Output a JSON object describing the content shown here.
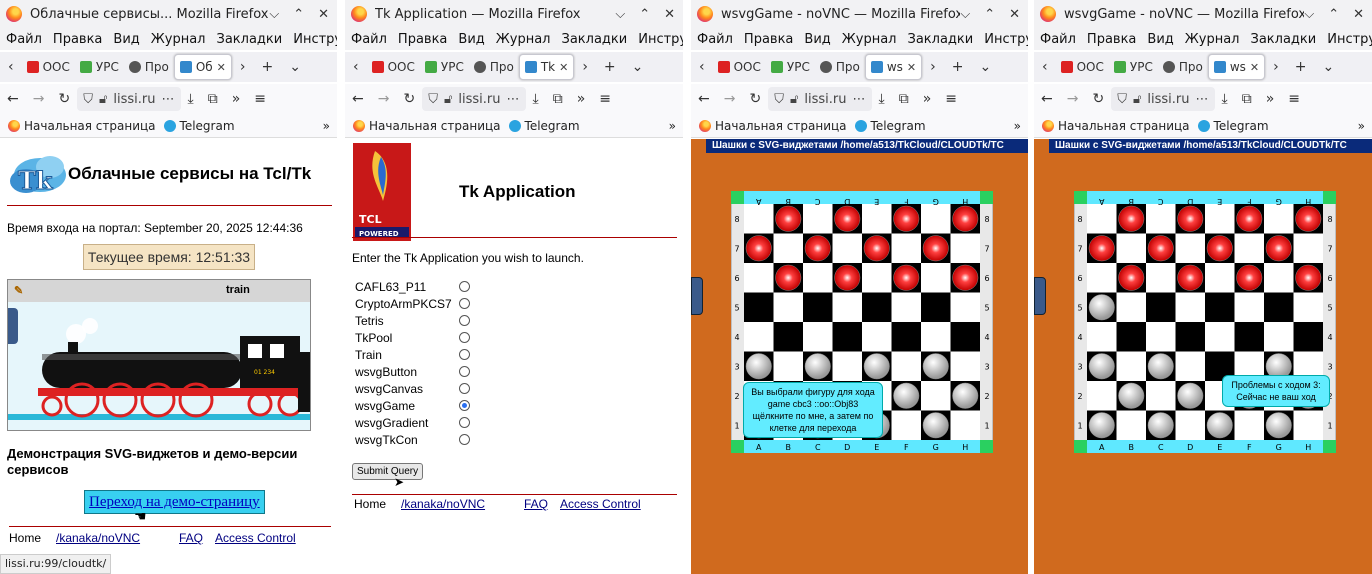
{
  "windows": [
    {
      "title": "Облачные сервисы... Mozilla Firefox",
      "menu": [
        "Файл",
        "Правка",
        "Вид",
        "Журнал",
        "Закладки",
        "Инструменты"
      ],
      "tabs": [
        {
          "label": "ООС",
          "active": false
        },
        {
          "label": "УРС",
          "active": false
        },
        {
          "label": "Про",
          "active": false
        },
        {
          "label": "Об",
          "active": true
        }
      ],
      "url": "lissi.ru",
      "bookmarks": [
        "Начальная страница",
        "Telegram"
      ]
    },
    {
      "title": "Tk Application — Mozilla Firefox",
      "menu": [
        "Файл",
        "Правка",
        "Вид",
        "Журнал",
        "Закладки",
        "Инструменты"
      ],
      "tabs": [
        {
          "label": "ООС",
          "active": false
        },
        {
          "label": "УРС",
          "active": false
        },
        {
          "label": "Про",
          "active": false
        },
        {
          "label": "Tk",
          "active": true
        }
      ],
      "url": "lissi.ru",
      "bookmarks": [
        "Начальная страница",
        "Telegram"
      ]
    },
    {
      "title": "wsvgGame - noVNC — Mozilla Firefox",
      "menu": [
        "Файл",
        "Правка",
        "Вид",
        "Журнал",
        "Закладки",
        "Инструменты"
      ],
      "tabs": [
        {
          "label": "ООС",
          "active": false
        },
        {
          "label": "УРС",
          "active": false
        },
        {
          "label": "Про",
          "active": false
        },
        {
          "label": "ws",
          "active": true
        }
      ],
      "url": "lissi.ru",
      "bookmarks": [
        "Начальная страница",
        "Telegram"
      ]
    },
    {
      "title": "wsvgGame - noVNC — Mozilla Firefox",
      "menu": [
        "Файл",
        "Правка",
        "Вид",
        "Журнал",
        "Закладки",
        "Инструменты"
      ],
      "tabs": [
        {
          "label": "ООС",
          "active": false
        },
        {
          "label": "УРС",
          "active": false
        },
        {
          "label": "Про",
          "active": false
        },
        {
          "label": "ws",
          "active": true
        }
      ],
      "url": "lissi.ru",
      "bookmarks": [
        "Начальная страница",
        "Telegram"
      ]
    }
  ],
  "portal": {
    "heading": "Облачные сервисы на Tcl/Tk",
    "login_time": "Время входа на портал: September 20, 2025 12:44:36",
    "current_time": "Текущее время: 12:51:33",
    "train_title": "train",
    "loco_number": "01 234",
    "demo_heading": "Демонстрация SVG-виджетов и демо-версии сервисов",
    "demo_link": "Переход на демо-страницу",
    "footer": {
      "home": "Home",
      "novnc": "/kanaka/noVNC",
      "faq": "FAQ",
      "access": "Access Control"
    },
    "status_url": "lissi.ru:99/cloudtk/"
  },
  "tkapp": {
    "logo_text": "TCL",
    "logo_sub": "POWERED",
    "heading": "Tk Application",
    "prompt": "Enter the Tk Application you wish to launch.",
    "apps": [
      "CAFL63_P11",
      "CryptoArmPKCS7",
      "Tetris",
      "TkPool",
      "Train",
      "wsvgButton",
      "wsvgCanvas",
      "wsvgGame",
      "wsvgGradient",
      "wsvgTkCon"
    ],
    "selected": "wsvgGame",
    "submit": "Submit Query",
    "footer": {
      "home": "Home",
      "novnc": "/kanaka/noVNC",
      "faq": "FAQ",
      "access": "Access Control"
    }
  },
  "game": {
    "window_title": "Шашки с SVG-виджетами /home/a513/TkCloud/CLOUDTk/TC",
    "window_title_b": "Шашки с SVG-виджетами /home/a513/TkCloud/CLOUDTk/TC",
    "files": [
      "A",
      "B",
      "C",
      "D",
      "E",
      "F",
      "G",
      "H"
    ],
    "ranks": [
      "8",
      "7",
      "6",
      "5",
      "4",
      "3",
      "2",
      "1"
    ],
    "tip_a": "Вы выбрали фигуру для хода game cbc3 ::oo::Obj83 щёлкните по мне, а затем по клетке для перехода",
    "tip_b": "Проблемы с ходом 3: Сейчас не ваш ход",
    "board_a": [
      [
        "",
        "r",
        "",
        "r",
        "",
        "r",
        "",
        "r"
      ],
      [
        "r",
        "",
        "r",
        "",
        "r",
        "",
        "r",
        ""
      ],
      [
        "",
        "r",
        "",
        "r",
        "",
        "r",
        "",
        "r"
      ],
      [
        "",
        "",
        "",
        "",
        "",
        "",
        "",
        ""
      ],
      [
        "",
        "",
        "",
        "",
        "",
        "",
        "",
        ""
      ],
      [
        "w",
        "",
        "w",
        "",
        "w",
        "",
        "w",
        ""
      ],
      [
        "",
        "w",
        "",
        "w",
        "",
        "w",
        "",
        "w"
      ],
      [
        "w",
        "",
        "w",
        "",
        "w",
        "",
        "w",
        ""
      ]
    ],
    "board_b": [
      [
        "",
        "r",
        "",
        "r",
        "",
        "r",
        "",
        "r"
      ],
      [
        "r",
        "",
        "r",
        "",
        "r",
        "",
        "r",
        ""
      ],
      [
        "",
        "r",
        "",
        "r",
        "",
        "r",
        "",
        "r"
      ],
      [
        "w",
        "",
        "",
        "",
        "",
        "",
        "",
        ""
      ],
      [
        "",
        "",
        "",
        "",
        "",
        "",
        "",
        ""
      ],
      [
        "w",
        "",
        "w",
        "",
        "",
        "",
        "w",
        ""
      ],
      [
        "",
        "w",
        "",
        "w",
        "",
        "w",
        "",
        "w"
      ],
      [
        "w",
        "",
        "w",
        "",
        "w",
        "",
        "w",
        ""
      ]
    ]
  },
  "colors": {
    "accent_rule": "#aa0000",
    "game_bg": "#d06a1e",
    "tip_bg": "#62ecff",
    "link": "#000080"
  }
}
